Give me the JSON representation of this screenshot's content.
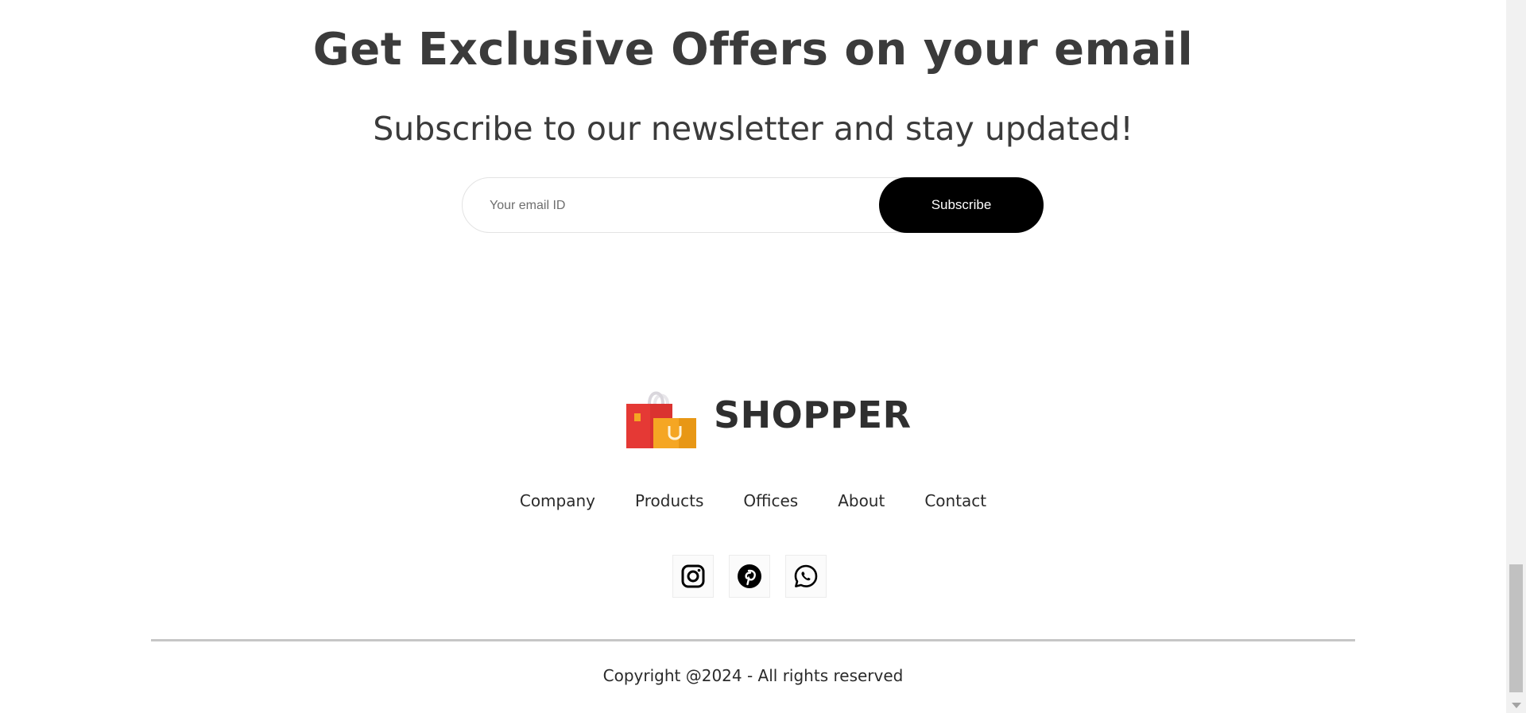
{
  "newsletter": {
    "headline": "Get Exclusive Offers on your email",
    "subheadline": "Subscribe to our newsletter and stay updated!",
    "email_placeholder": "Your email ID",
    "subscribe_label": "Subscribe"
  },
  "brand": {
    "name": "SHOPPER",
    "logo_icon": "shopping-bags-icon",
    "logo_letter": "U"
  },
  "footer_nav": {
    "items": [
      "Company",
      "Products",
      "Offices",
      "About",
      "Contact"
    ]
  },
  "social": {
    "icons": [
      "instagram-icon",
      "pinterest-icon",
      "whatsapp-icon"
    ]
  },
  "copyright": "Copyright @2024 - All rights reserved",
  "colors": {
    "heading_text": "#3b3b3b",
    "button_bg": "#000000",
    "button_text": "#ffffff",
    "divider": "#c6c6c6",
    "bag_red": "#e53935",
    "bag_orange": "#f5a623"
  }
}
